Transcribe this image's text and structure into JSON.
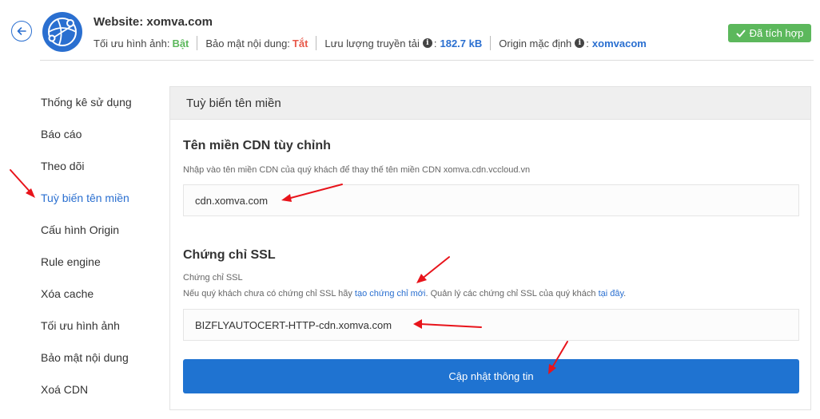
{
  "header": {
    "title": "Website: xomva.com",
    "image_opt_label": "Tối ưu hình ảnh:",
    "image_opt_value": "Bật",
    "content_security_label": "Bảo mật nội dung:",
    "content_security_value": "Tắt",
    "bandwidth_label": "Lưu lượng truyền tải",
    "bandwidth_value": "182.7 kB",
    "origin_label": "Origin mặc định",
    "origin_value": "xomvacom",
    "colon": ":",
    "badge_label": "Đã tích hợp",
    "info_glyph": "i"
  },
  "sidebar": {
    "items": [
      {
        "label": "Thống kê sử dụng"
      },
      {
        "label": "Báo cáo"
      },
      {
        "label": "Theo dõi"
      },
      {
        "label": "Tuỳ biến tên miền"
      },
      {
        "label": "Cấu hình Origin"
      },
      {
        "label": "Rule engine"
      },
      {
        "label": "Xóa cache"
      },
      {
        "label": "Tối ưu hình ảnh"
      },
      {
        "label": "Bảo mật nội dung"
      },
      {
        "label": "Xoá CDN"
      }
    ],
    "active_index": 3
  },
  "panel": {
    "title": "Tuỳ biến tên miền",
    "cdn_section": {
      "title": "Tên miền CDN tùy chỉnh",
      "help": "Nhập vào tên miền CDN của quý khách để thay thế tên miền CDN xomva.cdn.vccloud.vn",
      "value": "cdn.xomva.com"
    },
    "ssl_section": {
      "title": "Chứng chỉ SSL",
      "sub_label": "Chứng chỉ SSL",
      "help_prefix": "Nếu quý khách chưa có chứng chỉ SSL hãy",
      "help_link1": "tạo chứng chỉ mới",
      "help_middle": ". Quản lý các chứng chỉ SSL của quý khách",
      "help_link2": "tại đây",
      "help_suffix": ".",
      "value": "BIZFLYAUTOCERT-HTTP-cdn.xomva.com"
    },
    "submit_label": "Cập nhật thông tin"
  },
  "colors": {
    "accent": "#1f73d1",
    "success": "#5cb85c",
    "danger": "#e8594a",
    "annotation_arrow": "#e8141b"
  }
}
